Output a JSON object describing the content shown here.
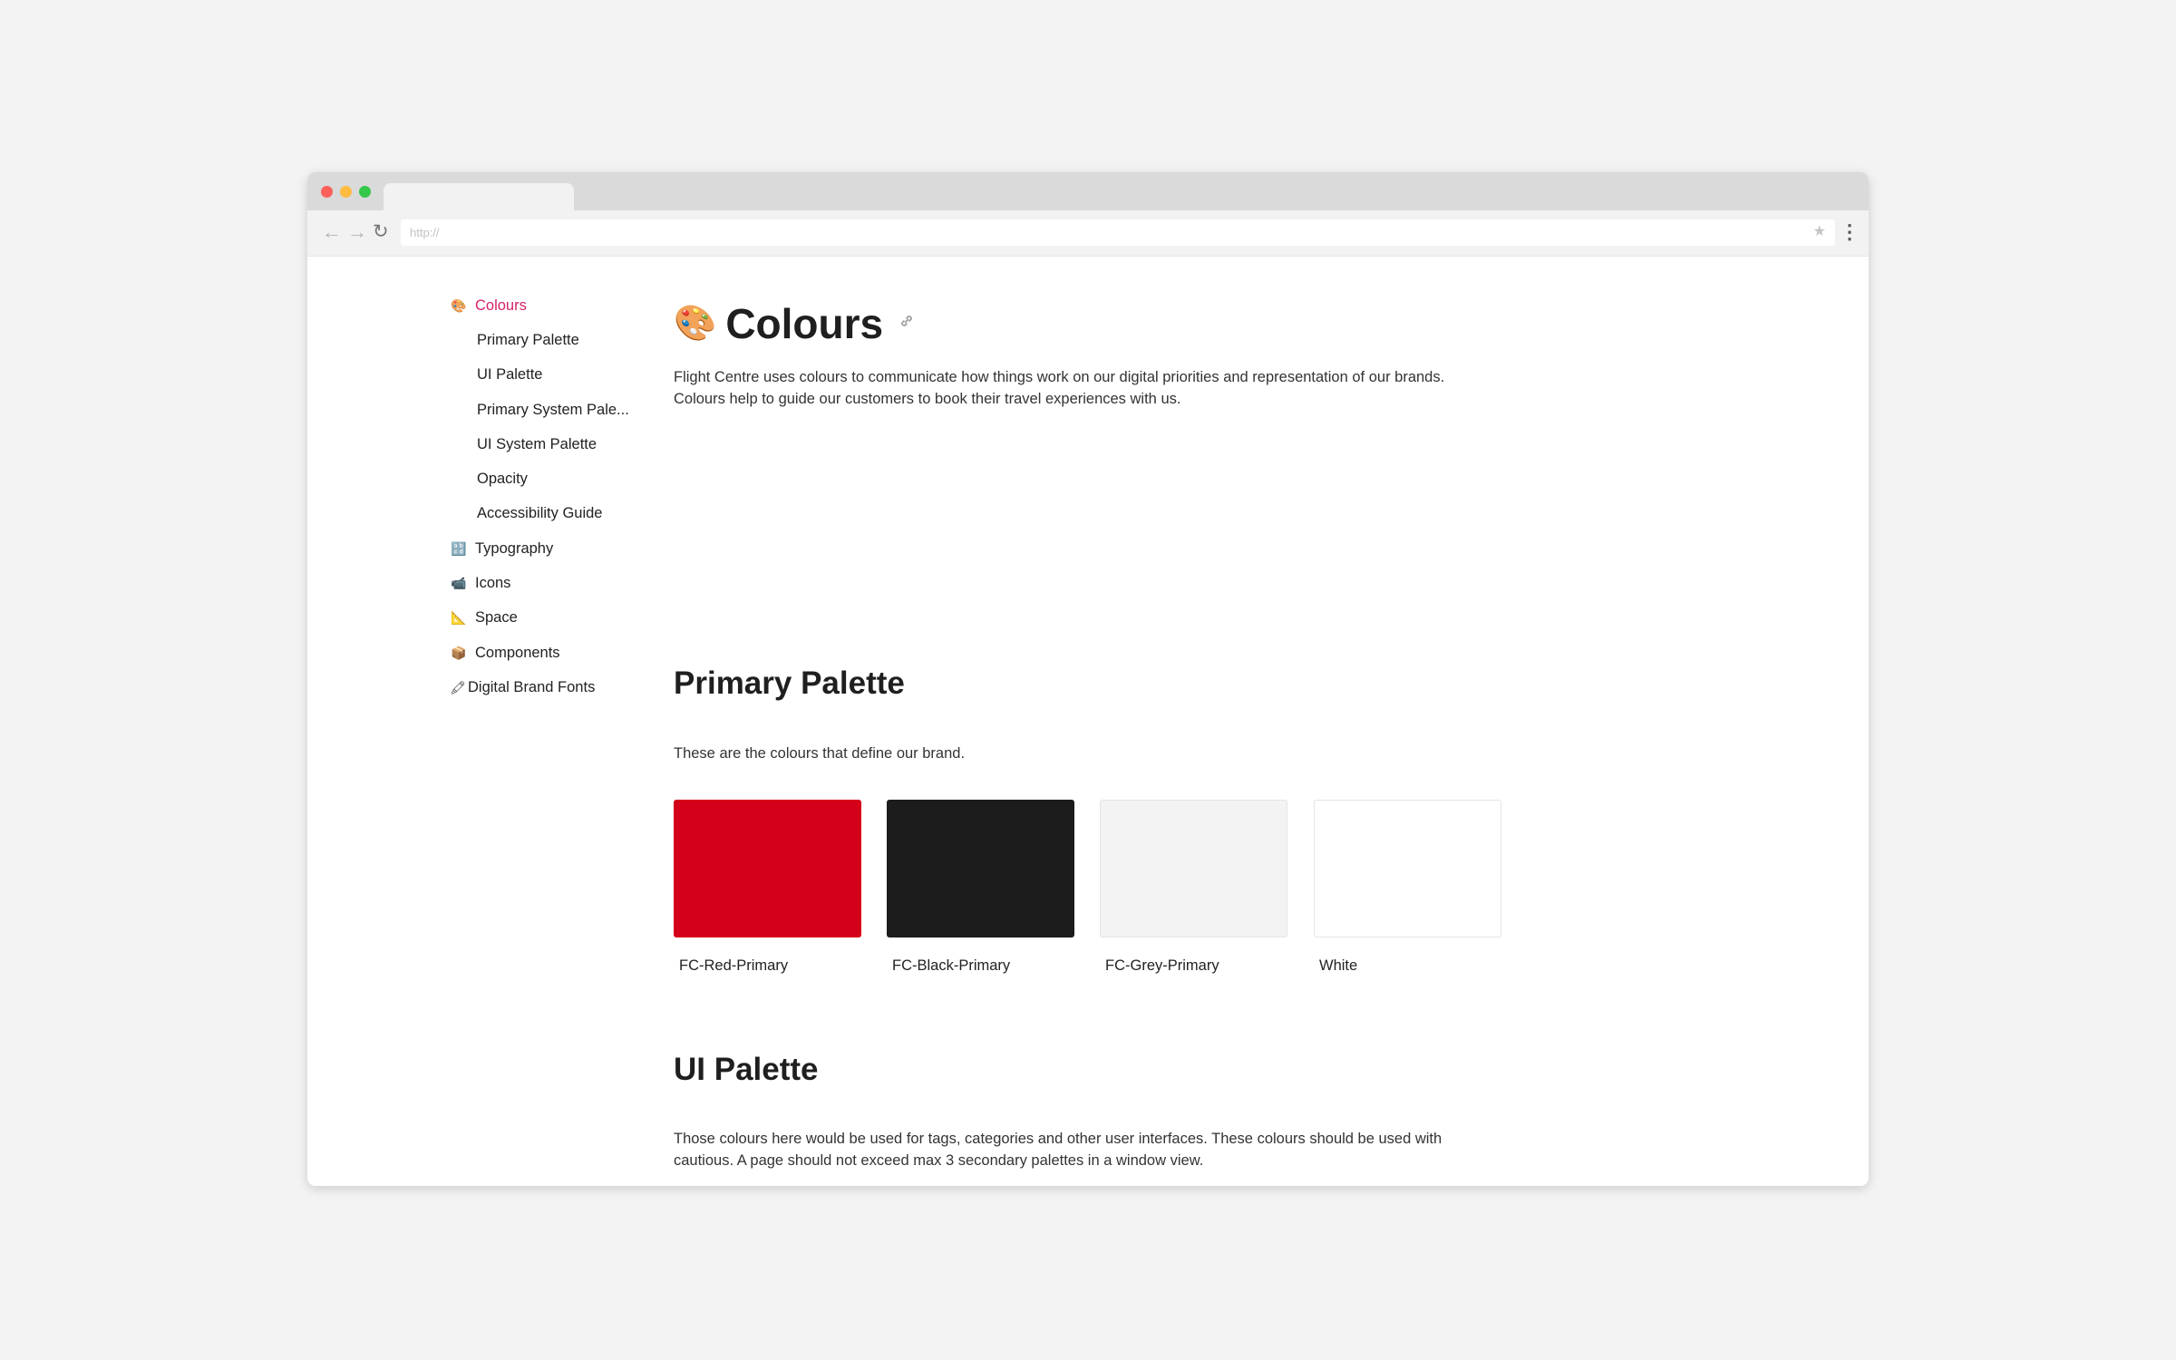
{
  "browser": {
    "url_placeholder": "http://",
    "nav": {
      "back": "←",
      "forward": "→",
      "reload": "↻"
    },
    "star_icon": "★",
    "menu_icon": "⋮"
  },
  "sidebar": {
    "items": [
      {
        "label": "Colours",
        "icon": "🎨",
        "active": true
      },
      {
        "label": "Primary Palette",
        "sub": true
      },
      {
        "label": "UI Palette",
        "sub": true
      },
      {
        "label": "Primary System Pale...",
        "sub": true
      },
      {
        "label": "UI System Palette",
        "sub": true
      },
      {
        "label": "Opacity",
        "sub": true
      },
      {
        "label": "Accessibility Guide",
        "sub": true
      },
      {
        "label": "Typography",
        "icon": "🔡"
      },
      {
        "label": "Icons",
        "icon": "📹"
      },
      {
        "label": "Space",
        "icon": "📐"
      },
      {
        "label": "Components",
        "icon": "📦"
      },
      {
        "label": "Digital Brand Fonts",
        "icon": "🖍"
      }
    ]
  },
  "page": {
    "title_icon": "🎨",
    "title": "Colours",
    "link_icon": "🔗",
    "intro_line1": "Flight Centre uses colours to communicate how things work on our digital priorities and representation of our brands.",
    "intro_line2": "Colours help to guide our customers to book their travel experiences with us."
  },
  "primary_palette": {
    "heading": "Primary Palette",
    "description": "These are the colours that define our brand.",
    "swatches": [
      {
        "label": "FC-Red-Primary",
        "color": "#d4001a"
      },
      {
        "label": "FC-Black-Primary",
        "color": "#1c1c1c"
      },
      {
        "label": "FC-Grey-Primary",
        "color": "#f3f3f3"
      },
      {
        "label": "White",
        "color": "#ffffff"
      }
    ]
  },
  "ui_palette": {
    "heading": "UI Palette",
    "description_line1": "Those colours here would be used for tags, categories and other user interfaces. These colours should be used with",
    "description_line2": "cautious. A page should not exceed max 3 secondary palettes in a window view.",
    "swatches": [
      {
        "color": "#00adc5"
      },
      {
        "color": "#ffb800"
      },
      {
        "color": "#73a833"
      },
      {
        "color": "#ee882c"
      }
    ]
  }
}
